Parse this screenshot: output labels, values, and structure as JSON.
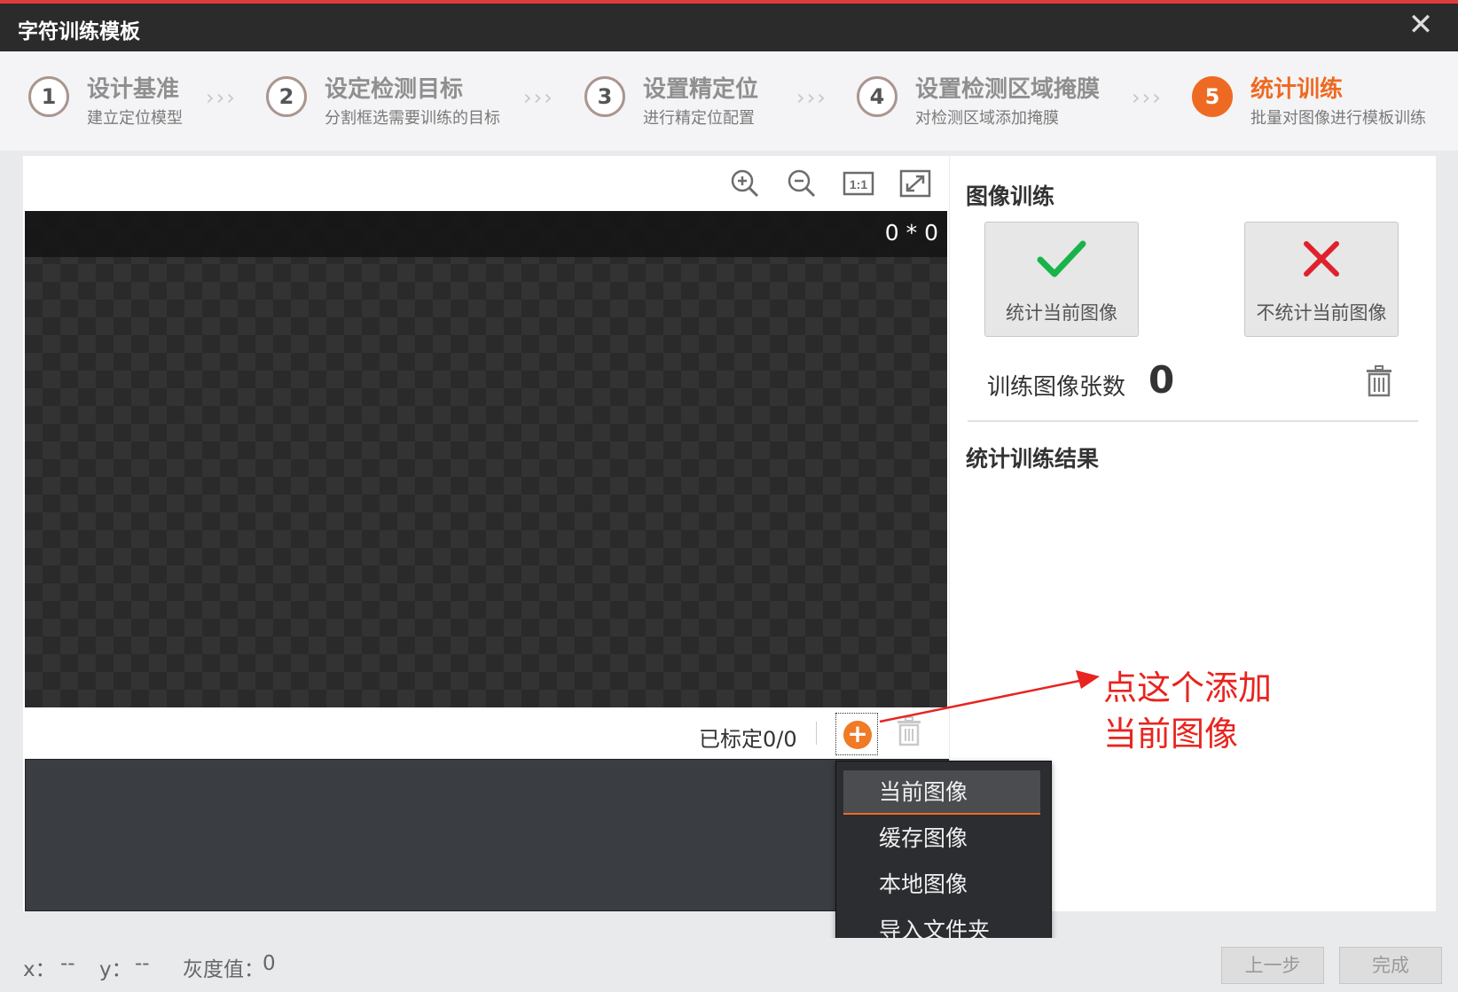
{
  "window": {
    "title": "字符训练模板",
    "close_glyph": "✕"
  },
  "steps": [
    {
      "num": "1",
      "title": "设计基准",
      "subtitle": "建立定位模型"
    },
    {
      "num": "2",
      "title": "设定检测目标",
      "subtitle": "分割框选需要训练的目标"
    },
    {
      "num": "3",
      "title": "设置精定位",
      "subtitle": "进行精定位配置"
    },
    {
      "num": "4",
      "title": "设置检测区域掩膜",
      "subtitle": "对检测区域添加掩膜"
    },
    {
      "num": "5",
      "title": "统计训练",
      "subtitle": "批量对图像进行模板训练"
    }
  ],
  "step_separator": "›››",
  "active_step": 5,
  "toolbar": {
    "icons": [
      "zoom-in-icon",
      "zoom-out-icon",
      "actual-size-icon",
      "fit-screen-icon"
    ],
    "actual_size_label": "1:1"
  },
  "canvas": {
    "size_text": "0 * 0"
  },
  "image_bar": {
    "marked_text": "已标定0/0",
    "add_glyph": "+"
  },
  "right": {
    "image_training_title": "图像训练",
    "count_current_label": "统计当前图像",
    "skip_current_label": "不统计当前图像",
    "train_count_label": "训练图像张数",
    "train_count_value": "0",
    "result_title": "统计训练结果"
  },
  "menu": {
    "items": [
      "当前图像",
      "缓存图像",
      "本地图像",
      "导入文件夹"
    ],
    "selected_index": 0
  },
  "annotation": {
    "line1": "点这个添加",
    "line2": "当前图像"
  },
  "status": {
    "x_label": "x：",
    "x_value": "--",
    "y_label": "y：",
    "y_value": "--",
    "gray_label": "灰度值：",
    "gray_value": "0"
  },
  "footer": {
    "prev_label": "上一步",
    "finish_label": "完成"
  },
  "colors": {
    "accent": "#ee6a22",
    "annotation": "#e8241f",
    "check": "#19b34a",
    "cross": "#e0212b"
  }
}
